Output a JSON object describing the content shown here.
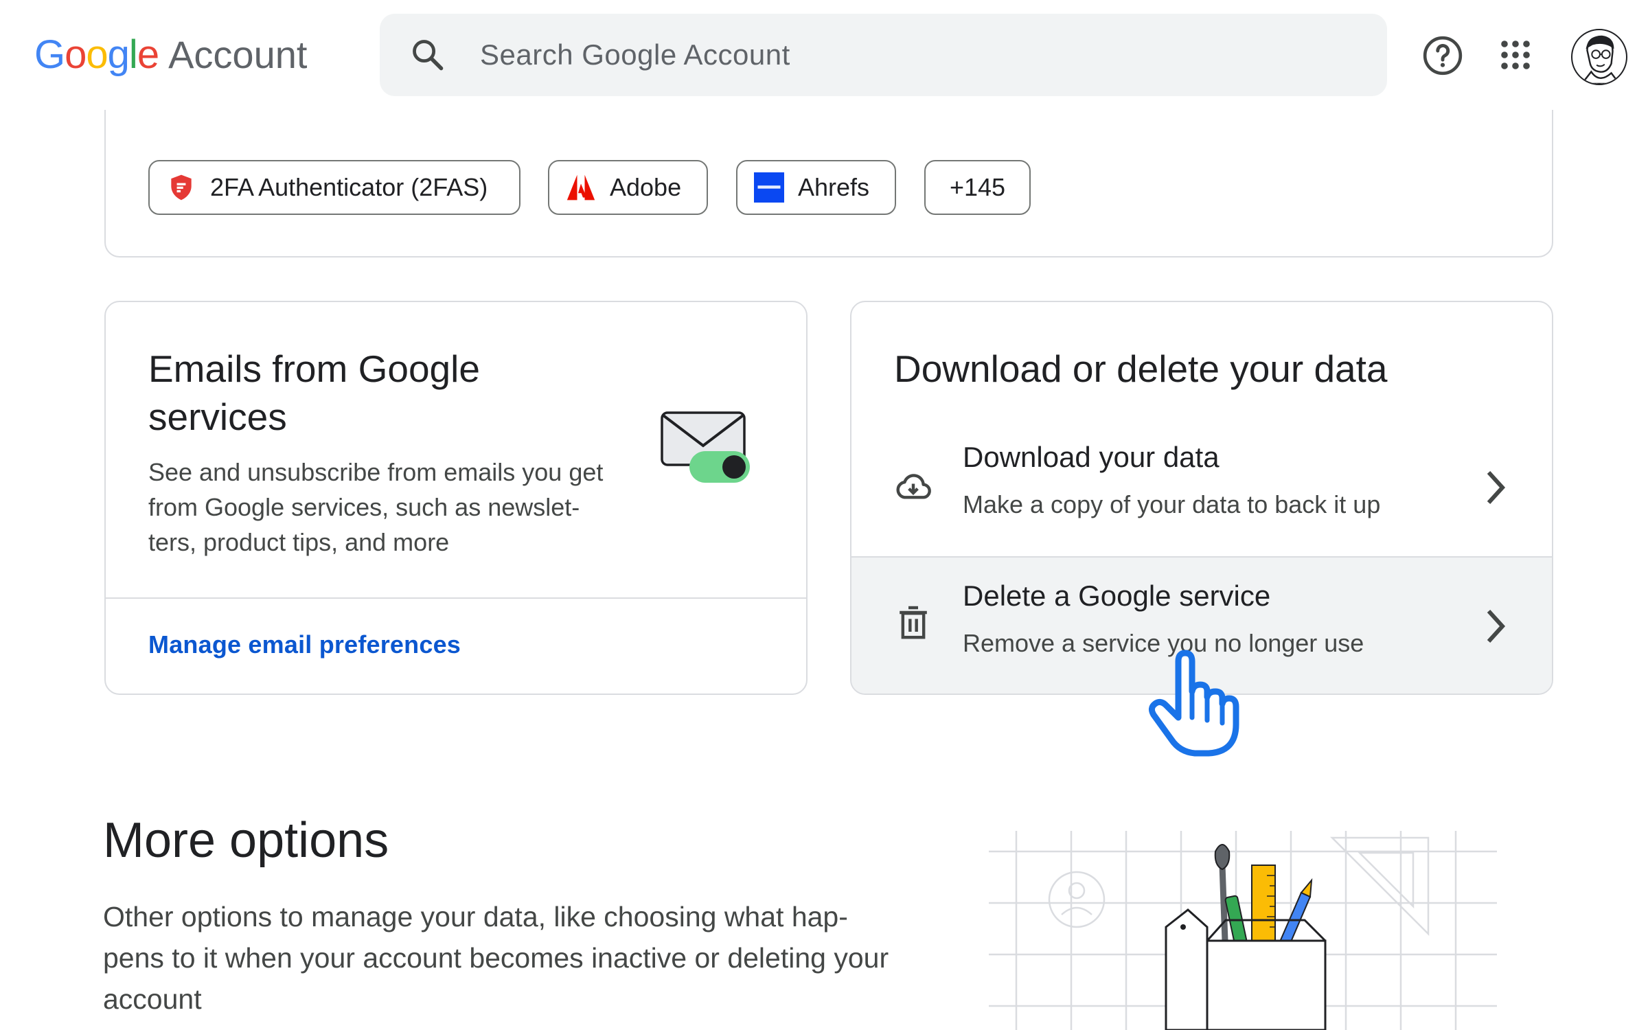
{
  "header": {
    "logo_google": "Google",
    "logo_account": "Account",
    "search_placeholder": "Search Google Account",
    "icons": [
      "search-icon",
      "help-icon",
      "apps-grid-icon",
      "avatar"
    ]
  },
  "connected_apps": {
    "chips": [
      {
        "label": "2FA Authenticator (2FAS)",
        "icon": "2fas-logo-icon"
      },
      {
        "label": "Adobe",
        "icon": "adobe-logo-icon"
      },
      {
        "label": "Ahrefs",
        "icon": "ahrefs-logo-icon"
      },
      {
        "label": "+145",
        "icon": ""
      }
    ]
  },
  "emails_card": {
    "title": "Emails from Google services",
    "description": "See and unsubscribe from emails you get from Google services, such as newslet- ters, product tips, and more",
    "link": "Manage email preferences"
  },
  "data_card": {
    "title": "Download or delete your data",
    "rows": [
      {
        "title": "Download your data",
        "subtitle": "Make a copy of your data to back it up",
        "icon": "cloud-download-icon"
      },
      {
        "title": "Delete a Google service",
        "subtitle": "Remove a service you no longer use",
        "icon": "trash-icon"
      }
    ]
  },
  "more_options": {
    "title": "More options",
    "description": "Other options to manage your data, like choosing what hap- pens to it when your account becomes inactive or deleting your account"
  },
  "colors": {
    "google_blue": "#4285F4",
    "google_red": "#EA4335",
    "google_yellow": "#FBBC05",
    "google_green": "#34A853",
    "link_blue": "#0b57d0",
    "cursor_blue": "#1a73e8"
  }
}
